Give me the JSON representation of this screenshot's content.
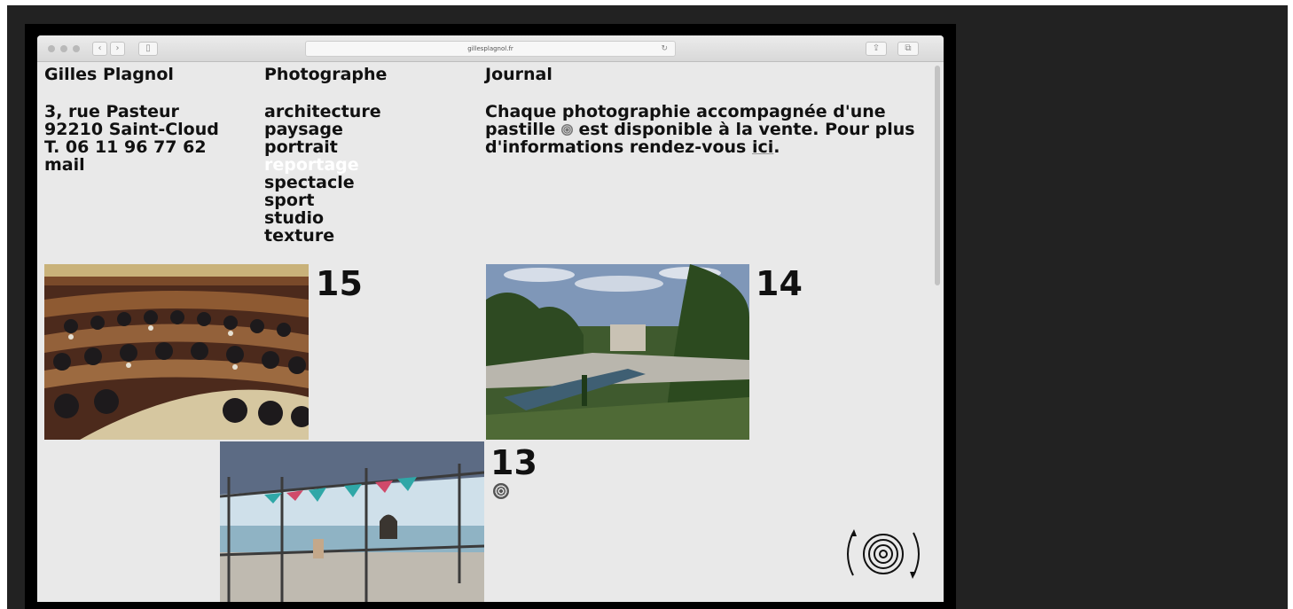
{
  "browser": {
    "url": "gillesplagnol.fr",
    "icons": [
      "back-icon",
      "forward-icon",
      "sidebar-icon",
      "reload-icon",
      "share-icon",
      "tabs-icon"
    ]
  },
  "site": {
    "name": "Gilles Plagnol",
    "address": [
      "3, rue Pasteur",
      "92210 Saint-Cloud",
      "T. 06 11 96 77 62"
    ],
    "mail_label": "mail",
    "nav_title": "Photographe",
    "nav_items": [
      "architecture",
      "paysage",
      "portrait",
      "reportage",
      "spectacle",
      "sport",
      "studio",
      "texture"
    ],
    "active_nav": "reportage",
    "journal_title": "Journal",
    "journal_text_1": "Chaque photographie accompagnée d'une pastille",
    "journal_text_2": "est disponible à la vente. Pour plus d'informations rendez-vous",
    "journal_link": "ici",
    "journal_end": "."
  },
  "photos": [
    {
      "number": "15",
      "subject": "assembly hall"
    },
    {
      "number": "14",
      "subject": "garden pool"
    },
    {
      "number": "13",
      "subject": "beach pergola",
      "pastille": true
    }
  ],
  "colors": {
    "page_bg": "#e9e9e9",
    "text": "#111111",
    "active_nav": "#ffffff",
    "outer_bg": "#222222"
  }
}
